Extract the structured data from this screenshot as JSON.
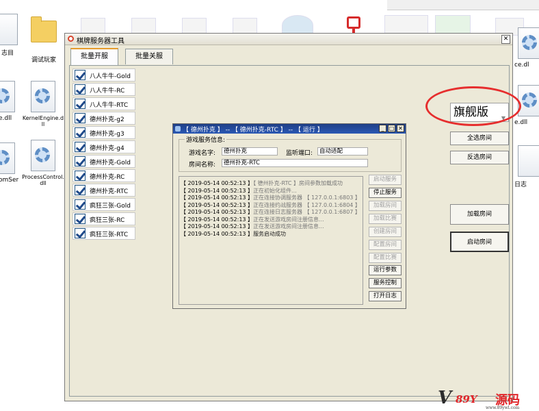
{
  "desktop": {
    "icons": [
      {
        "label": "志目"
      },
      {
        "label": "调试玩家"
      },
      {
        "label": "e.dll"
      },
      {
        "label": "KernelEngine.dll"
      },
      {
        "label": "omSer l"
      },
      {
        "label": "ProcessControl.dll"
      },
      {
        "label": "ce.dl"
      },
      {
        "label": "e.dll"
      },
      {
        "label": "日志"
      }
    ]
  },
  "main_window": {
    "title": "棋牌服务器工具",
    "tabs": [
      {
        "label": "批量开服",
        "active": true
      },
      {
        "label": "批量关服",
        "active": false
      }
    ],
    "rooms": [
      {
        "label": "八人牛牛-Gold",
        "checked": true
      },
      {
        "label": "八人牛牛-RC",
        "checked": true
      },
      {
        "label": "八人牛牛-RTC",
        "checked": true
      },
      {
        "label": "德州扑克-g2",
        "checked": true
      },
      {
        "label": "德州扑克-g3",
        "checked": true
      },
      {
        "label": "德州扑克-g4",
        "checked": true
      },
      {
        "label": "德州扑克-Gold",
        "checked": true
      },
      {
        "label": "德州扑克-RC",
        "checked": true
      },
      {
        "label": "德州扑克-RTC",
        "checked": true
      },
      {
        "label": "疯狂三张-Gold",
        "checked": true
      },
      {
        "label": "疯狂三张-RC",
        "checked": true
      },
      {
        "label": "疯狂三张-RTC",
        "checked": true
      }
    ],
    "version": "旗舰版",
    "buttons": {
      "select_all": "全选房间",
      "invert_select": "反选房间",
      "load_rooms": "加载房间",
      "start_rooms": "启动房间"
    }
  },
  "dialog": {
    "title": "【 德州扑克 】 -- 【 德州扑克-RTC 】 -- 【 运行 】",
    "group_label": "游戏服务信息:",
    "fields": {
      "game_name_label": "游戏名字:",
      "game_name_value": "德州扑克",
      "port_label": "监听端口:",
      "port_value": "自动适配",
      "room_name_label": "房间名称:",
      "room_name_value": "德州扑克-RTC"
    },
    "log": [
      {
        "ts": "【 2019-05-14 00:52:13 】",
        "msg": "【 德州扑克-RTC 】房间参数加载成功"
      },
      {
        "ts": "【 2019-05-14 00:52:13 】",
        "msg": "正在初始化组件..."
      },
      {
        "ts": "【 2019-05-14 00:52:13 】",
        "msg": "正在连接协调服务器 【 127.0.0.1:6803 】"
      },
      {
        "ts": "【 2019-05-14 00:52:13 】",
        "msg": "正在连接约战服务器 【 127.0.0.1:6804 】"
      },
      {
        "ts": "【 2019-05-14 00:52:13 】",
        "msg": "正在连接日志服务器 【 127.0.0.1:6807 】"
      },
      {
        "ts": "【 2019-05-14 00:52:13 】",
        "msg": "正在发送游戏房间注册信息..."
      },
      {
        "ts": "【 2019-05-14 00:52:13 】",
        "msg": "正在发送游戏房间注册信息..."
      },
      {
        "ts": "【 2019-05-14 00:52:13 】",
        "msg": "服务启动成功"
      }
    ],
    "buttons": [
      {
        "label": "启动服务",
        "enabled": false
      },
      {
        "label": "停止服务",
        "enabled": true
      },
      {
        "label": "加载房间",
        "enabled": false
      },
      {
        "label": "加载比赛",
        "enabled": false
      },
      {
        "label": "创建房间",
        "enabled": false
      },
      {
        "label": "配置房间",
        "enabled": false
      },
      {
        "label": "配置比赛",
        "enabled": false
      },
      {
        "label": "运行参数",
        "enabled": true
      },
      {
        "label": "服务控制",
        "enabled": true
      },
      {
        "label": "打开日志",
        "enabled": true
      }
    ]
  },
  "watermark": {
    "brand_v": "V",
    "brand_mid": "89Y",
    "brand_cn": "源码",
    "url": "www.89ywl.com"
  }
}
